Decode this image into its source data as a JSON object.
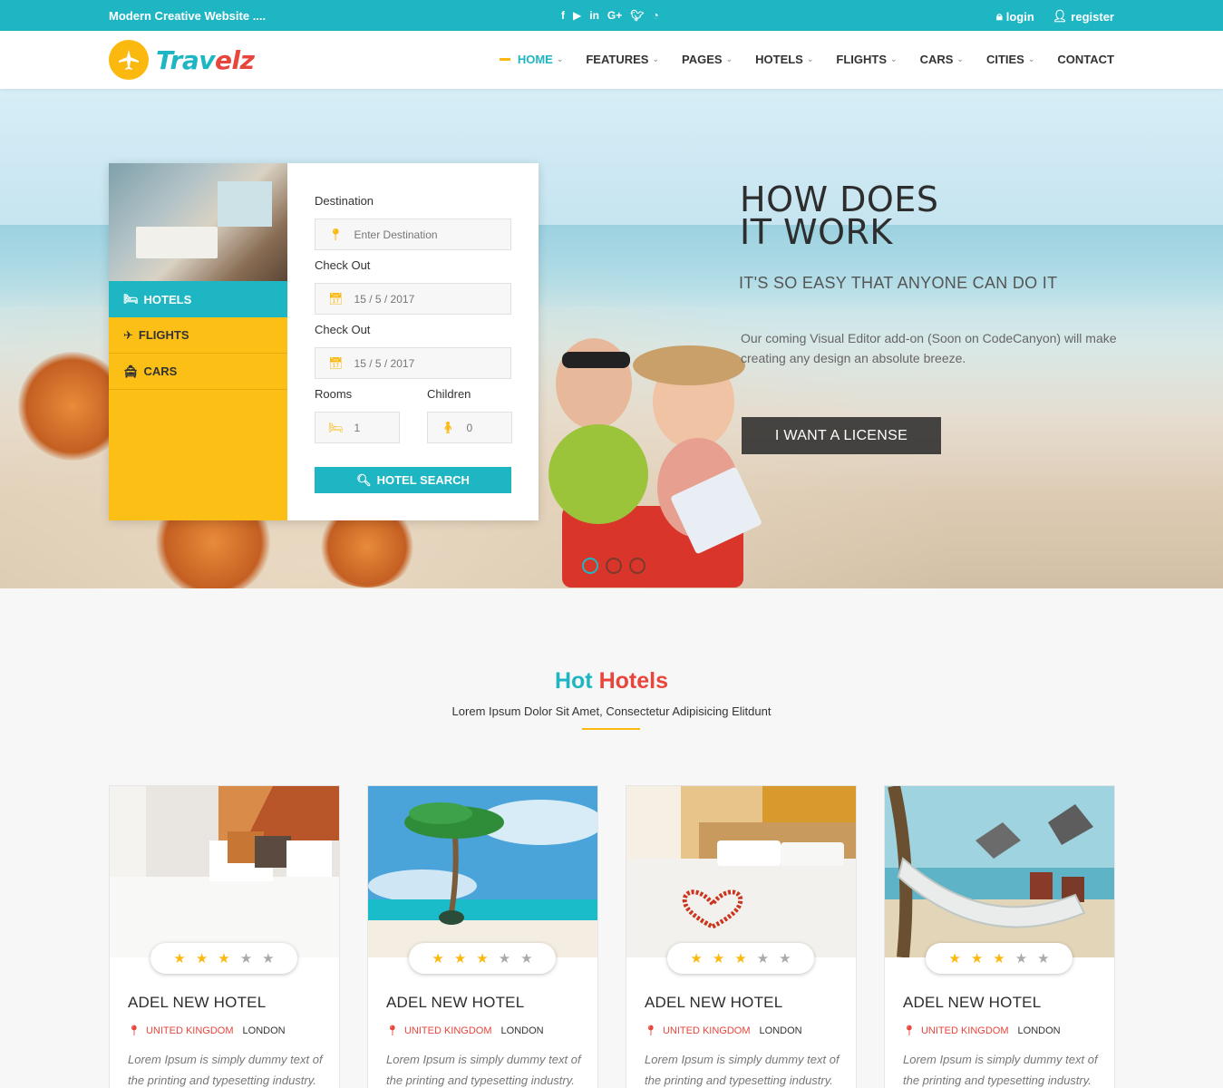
{
  "topbar": {
    "tagline": "Modern Creative Website ....",
    "social": [
      "facebook-icon",
      "youtube-icon",
      "linkedin-icon",
      "google-plus-icon",
      "twitter-icon",
      "rss-icon"
    ],
    "login": "login",
    "register": "register"
  },
  "nav": {
    "logo_main": "Trav",
    "logo_accent": "elz",
    "items": [
      {
        "label": "HOME",
        "dropdown": true
      },
      {
        "label": "FEATURES",
        "dropdown": true
      },
      {
        "label": "PAGES",
        "dropdown": true
      },
      {
        "label": "HOTELS",
        "dropdown": true
      },
      {
        "label": "FLIGHTS",
        "dropdown": true
      },
      {
        "label": "CARS",
        "dropdown": true
      },
      {
        "label": "CITIES",
        "dropdown": true
      },
      {
        "label": "CONTACT",
        "dropdown": false
      }
    ]
  },
  "search": {
    "tabs": [
      "HOTELS",
      "FLIGHTS",
      "CARS"
    ],
    "destination_label": "Destination",
    "destination_placeholder": "Enter Destination",
    "checkin_label": "Check Out",
    "checkin_value": "15 / 5 / 2017",
    "checkout_label": "Check Out",
    "checkout_value": "15 / 5 / 2017",
    "rooms_label": "Rooms",
    "rooms_value": "1",
    "children_label": "Children",
    "children_value": "0",
    "button": "HOTEL SEARCH"
  },
  "hero": {
    "title_line1": "HOW DOES",
    "title_line2": "IT WORK",
    "subtitle": "IT'S SO EASY THAT ANYONE CAN DO IT",
    "description": "Our coming Visual Editor add-on (Soon on CodeCanyon) will make creating any design an absolute breeze.",
    "cta": "I WANT A LICENSE",
    "slides": 3,
    "active_slide": 1
  },
  "hot_hotels": {
    "title_part1": "Hot",
    "title_part2": "Hotels",
    "subtitle": "Lorem Ipsum Dolor Sit Amet, Consectetur Adipisicing Elitdunt",
    "cards": [
      {
        "name": "ADEL NEW HOTEL",
        "country": "UNITED KINGDOM",
        "city": "LONDON",
        "rating": 3,
        "desc": "Lorem Ipsum is simply dummy text of the printing and typesetting industry."
      },
      {
        "name": "ADEL NEW HOTEL",
        "country": "UNITED KINGDOM",
        "city": "LONDON",
        "rating": 3,
        "desc": "Lorem Ipsum is simply dummy text of the printing and typesetting industry."
      },
      {
        "name": "ADEL NEW HOTEL",
        "country": "UNITED KINGDOM",
        "city": "LONDON",
        "rating": 3,
        "desc": "Lorem Ipsum is simply dummy text of the printing and typesetting industry."
      },
      {
        "name": "ADEL NEW HOTEL",
        "country": "UNITED KINGDOM",
        "city": "LONDON",
        "rating": 3,
        "desc": "Lorem Ipsum is simply dummy text of the printing and typesetting industry."
      }
    ]
  },
  "colors": {
    "teal": "#1fb6c4",
    "yellow": "#fbbf15",
    "red": "#e8453c",
    "dark": "#2d2d2d"
  }
}
